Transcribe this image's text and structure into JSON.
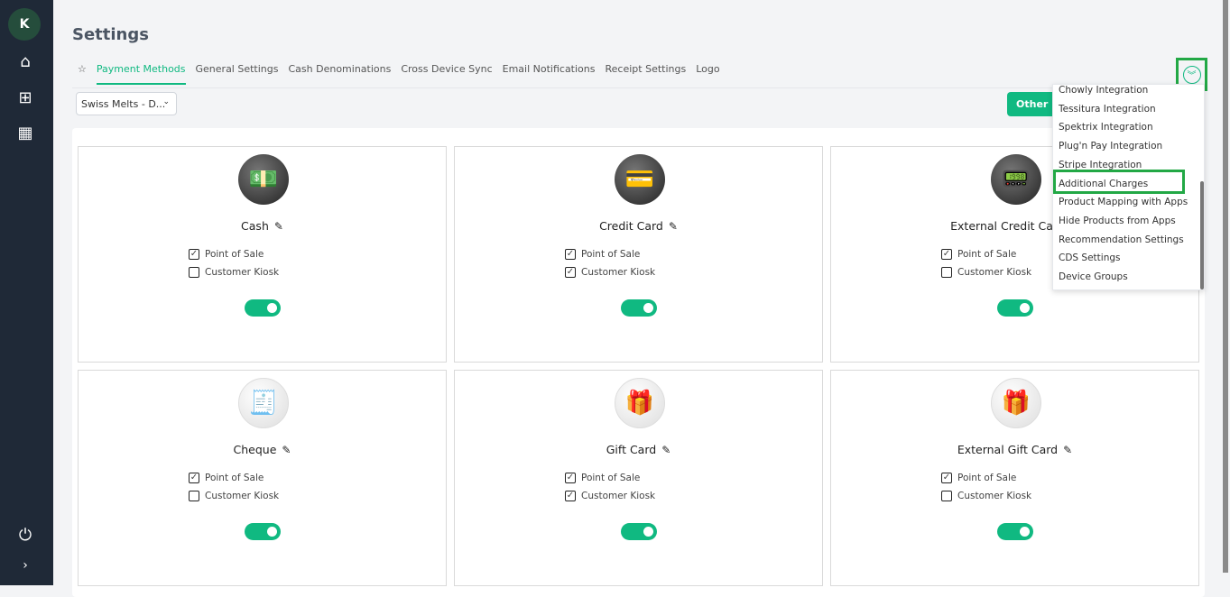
{
  "sidebar": {
    "avatar": "K",
    "icons": [
      "home-icon",
      "gift-icon",
      "store-icon"
    ],
    "logout": "power-icon",
    "expand": "chevron-right-icon"
  },
  "header": {
    "title": "Settings"
  },
  "tabs": [
    {
      "label": "Payment Methods",
      "active": true
    },
    {
      "label": "General Settings"
    },
    {
      "label": "Cash Denominations"
    },
    {
      "label": "Cross Device Sync"
    },
    {
      "label": "Email Notifications"
    },
    {
      "label": "Receipt Settings"
    },
    {
      "label": "Logo"
    }
  ],
  "store_select": {
    "value": "Swiss Melts - D..."
  },
  "other_button": "Other Payment Methods",
  "colors": {
    "accent": "#10b981",
    "highlight": "#22a845",
    "sidebar": "#1f2937"
  },
  "cards": [
    {
      "name": "Cash",
      "icon": "💵",
      "pos": true,
      "kiosk": false,
      "enabled": true
    },
    {
      "name": "Credit Card",
      "icon": "💳",
      "pos": true,
      "kiosk": true,
      "enabled": true
    },
    {
      "name": "External Credit Card",
      "icon": "📟",
      "pos": true,
      "kiosk": false,
      "enabled": true
    },
    {
      "name": "Cheque",
      "icon": "🧾",
      "pos": true,
      "kiosk": false,
      "enabled": true
    },
    {
      "name": "Gift Card",
      "icon": "🎁",
      "pos": true,
      "kiosk": true,
      "enabled": true
    },
    {
      "name": "External Gift Card",
      "icon": "🎁",
      "pos": true,
      "kiosk": false,
      "enabled": true
    }
  ],
  "labels": {
    "pos": "Point of Sale",
    "kiosk": "Customer Kiosk"
  },
  "menu": {
    "items": [
      "Chowly Integration",
      "Tessitura Integration",
      "Spektrix Integration",
      "Plug'n Pay Integration",
      "Stripe Integration",
      "Additional Charges",
      "Product Mapping with Apps",
      "Hide Products from Apps",
      "Recommendation Settings",
      "CDS Settings",
      "Device Groups"
    ],
    "highlighted": "Additional Charges"
  }
}
